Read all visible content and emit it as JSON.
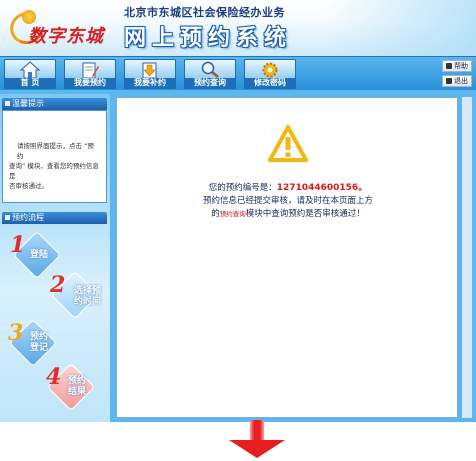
{
  "header": {
    "logo_text": "数字东城",
    "org_name": "北京市东城区社会保险经办业务",
    "system_name": "网上预约系统"
  },
  "nav": {
    "items": [
      {
        "label": "首  页",
        "icon": "home-icon"
      },
      {
        "label": "我要预约",
        "icon": "pencil-icon"
      },
      {
        "label": "我要补约",
        "icon": "download-arrow-icon"
      },
      {
        "label": "预约查询",
        "icon": "magnifier-icon"
      },
      {
        "label": "修改密码",
        "icon": "gear-icon"
      }
    ],
    "help_label": "帮助",
    "logout_label": "退出"
  },
  "sidebar": {
    "tips_title": "温馨提示",
    "tips_text_1": "请按照界面提示，点击 “预约",
    "tips_text_2": "查询” 模块，查看您的预约信息是",
    "tips_text_3": "否审核通过。",
    "flow_title": "预约流程",
    "steps": [
      {
        "number": "1",
        "name": "登陆"
      },
      {
        "number": "2",
        "name_line1": "选择预",
        "name_line2": "约时间"
      },
      {
        "number": "3",
        "name_line1": "预约",
        "name_line2": "登记"
      },
      {
        "number": "4",
        "name_line1": "预约",
        "name_line2": "结果"
      }
    ]
  },
  "main": {
    "line1_prefix": "您的预约编号是：",
    "appointment_number": "1271044600156",
    "line1_suffix": "。",
    "line2": "预约信息已经提交审核，请及时在本页面上方",
    "line3_prefix": "的",
    "line3_link": "预约查询",
    "line3_suffix": "模块中查询预约是否审核通过！"
  },
  "colors": {
    "nav_bg": "#2a8fd8",
    "warning_yellow": "#f2b80f",
    "number_red": "#d81a1a",
    "arrow_red": "#e61e1e"
  }
}
